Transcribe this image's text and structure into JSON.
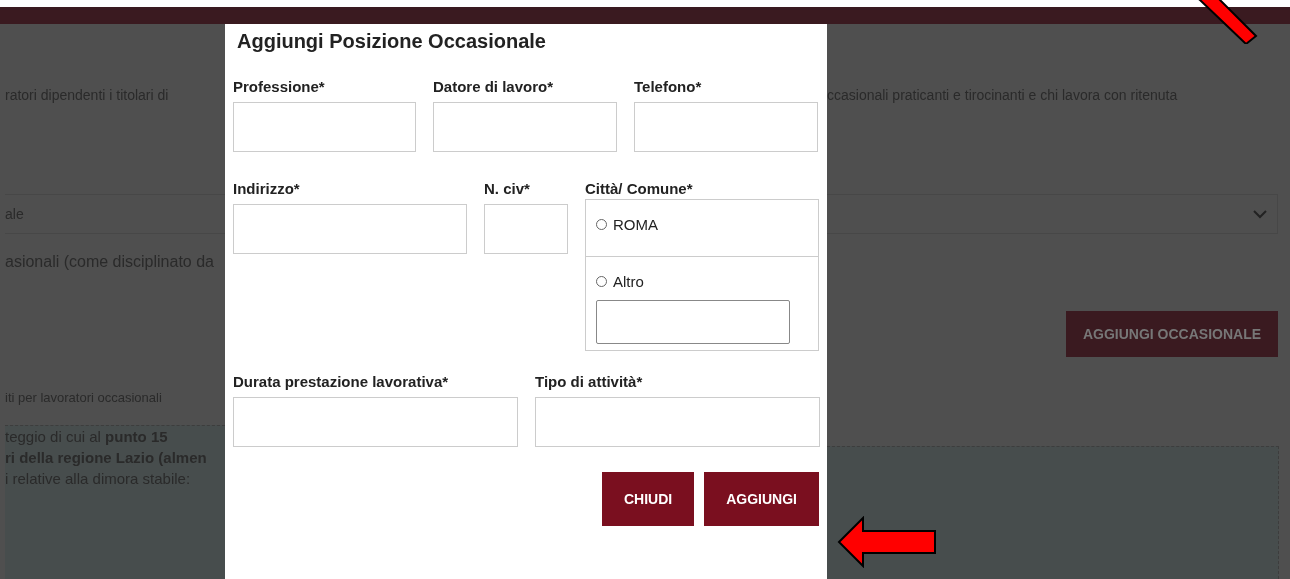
{
  "page": {
    "intro_left": "ratori dipendenti i titolari di",
    "intro_right": "ccasionali praticanti e tirocinanti e chi lavora con ritenuta",
    "select_value": "ale",
    "section_text": "asionali (come disciplinato da",
    "add_button": "AGGIUNGI OCCASIONALE",
    "subsection_title": "iti per lavoratori occasionali",
    "info_lines": [
      {
        "text": "teggio di cui al **punto 15**",
        "bold": false
      },
      {
        "text": "ri della regione Lazio (almen",
        "bold": true
      },
      {
        "text": "i relative alla dimora stabile:",
        "bold": false
      }
    ]
  },
  "modal": {
    "title": "Aggiungi Posizione Occasionale",
    "rows": [
      [
        {
          "label": "Professione*",
          "kind": "text"
        },
        {
          "label": "Datore di lavoro*",
          "kind": "text"
        },
        {
          "label": "Telefono*",
          "kind": "text"
        }
      ],
      [
        {
          "label": "Indirizzo*",
          "kind": "text"
        },
        {
          "label": "N. civ*",
          "kind": "text"
        },
        {
          "label": "Città/ Comune*",
          "kind": "radio-group",
          "options": [
            {
              "label": "ROMA",
              "selected": false,
              "kind": "plain"
            },
            {
              "label": "Altro",
              "selected": false,
              "kind": "with-input"
            }
          ]
        }
      ],
      [
        {
          "label": "Durata prestazione lavorativa*",
          "kind": "text"
        },
        {
          "label": "Tipo di attività*",
          "kind": "text"
        }
      ]
    ],
    "buttons": [
      "CHIUDI",
      "AGGIUNGI"
    ]
  }
}
